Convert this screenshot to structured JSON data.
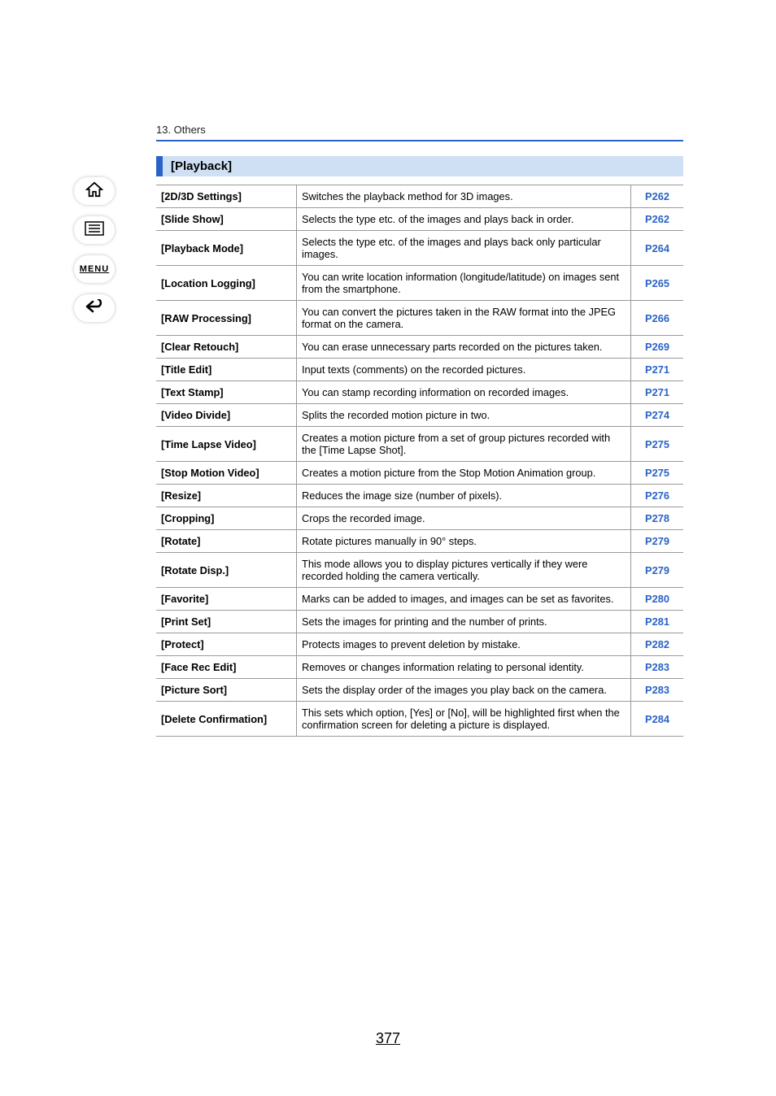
{
  "chapter_label": "13. Others",
  "page_number": "377",
  "nav": {
    "menu_label": "MENU"
  },
  "section": {
    "title": "[Playback]"
  },
  "rows": [
    {
      "name": "[2D/3D Settings]",
      "desc": "Switches the playback method for 3D images.",
      "page": "P262"
    },
    {
      "name": "[Slide Show]",
      "desc": "Selects the type etc. of the images and plays back in order.",
      "page": "P262"
    },
    {
      "name": "[Playback Mode]",
      "desc": "Selects the type etc. of the images and plays back only particular images.",
      "page": "P264"
    },
    {
      "name": "[Location Logging]",
      "desc": "You can write location information (longitude/latitude) on images sent from the smartphone.",
      "page": "P265"
    },
    {
      "name": "[RAW Processing]",
      "desc": "You can convert the pictures taken in the RAW format into the JPEG format on the camera.",
      "page": "P266"
    },
    {
      "name": "[Clear Retouch]",
      "desc": "You can erase unnecessary parts recorded on the pictures taken.",
      "page": "P269"
    },
    {
      "name": "[Title Edit]",
      "desc": "Input texts (comments) on the recorded pictures.",
      "page": "P271"
    },
    {
      "name": "[Text Stamp]",
      "desc": "You can stamp recording information on recorded images.",
      "page": "P271"
    },
    {
      "name": "[Video Divide]",
      "desc": "Splits the recorded motion picture in two.",
      "page": "P274"
    },
    {
      "name": "[Time Lapse Video]",
      "desc": "Creates a motion picture from a set of group pictures recorded with the [Time Lapse Shot].",
      "page": "P275"
    },
    {
      "name": "[Stop Motion Video]",
      "desc": "Creates a motion picture from the Stop Motion Animation group.",
      "page": "P275"
    },
    {
      "name": "[Resize]",
      "desc": "Reduces the image size (number of pixels).",
      "page": "P276"
    },
    {
      "name": "[Cropping]",
      "desc": "Crops the recorded image.",
      "page": "P278"
    },
    {
      "name": "[Rotate]",
      "desc": "Rotate pictures manually in 90° steps.",
      "page": "P279"
    },
    {
      "name": "[Rotate Disp.]",
      "desc": "This mode allows you to display pictures vertically if they were recorded holding the camera vertically.",
      "page": "P279"
    },
    {
      "name": "[Favorite]",
      "desc": "Marks can be added to images, and images can be set as favorites.",
      "page": "P280"
    },
    {
      "name": "[Print Set]",
      "desc": "Sets the images for printing and the number of prints.",
      "page": "P281"
    },
    {
      "name": "[Protect]",
      "desc": "Protects images to prevent deletion by mistake.",
      "page": "P282"
    },
    {
      "name": "[Face Rec Edit]",
      "desc": "Removes or changes information relating to personal identity.",
      "page": "P283"
    },
    {
      "name": "[Picture Sort]",
      "desc": "Sets the display order of the images you play back on the camera.",
      "page": "P283"
    },
    {
      "name": "[Delete Confirmation]",
      "desc": "This sets which option, [Yes] or [No], will be highlighted first when the confirmation screen for deleting a picture is displayed.",
      "page": "P284"
    }
  ]
}
